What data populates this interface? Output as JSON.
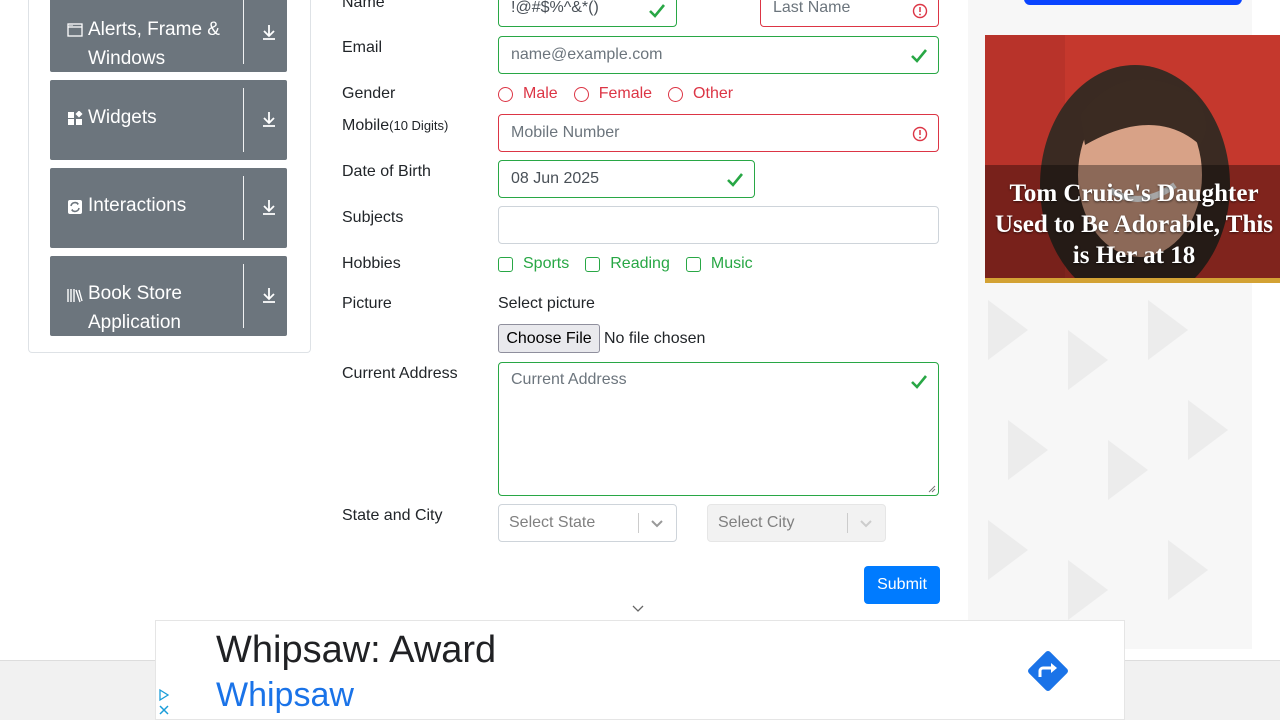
{
  "sidebar": {
    "items": [
      {
        "label_line1": "Alerts, Frame &",
        "label_line2": "Windows",
        "icon": "window-icon"
      },
      {
        "label": "Widgets",
        "icon": "widgets-icon"
      },
      {
        "label": "Interactions",
        "icon": "interactions-icon"
      },
      {
        "label_line1": "Book Store",
        "label_line2": "Application",
        "icon": "book-icon"
      }
    ]
  },
  "form": {
    "name_label": "Name",
    "first_name_value": "!@#$%^&*()",
    "last_name_placeholder": "Last Name",
    "email_label": "Email",
    "email_placeholder": "name@example.com",
    "gender_label": "Gender",
    "genders": [
      "Male",
      "Female",
      "Other"
    ],
    "mobile_label": "Mobile",
    "mobile_hint": "(10 Digits)",
    "mobile_placeholder": "Mobile Number",
    "dob_label": "Date of Birth",
    "dob_value": "08 Jun 2025",
    "subjects_label": "Subjects",
    "hobbies_label": "Hobbies",
    "hobbies": [
      "Sports",
      "Reading",
      "Music"
    ],
    "picture_label": "Picture",
    "select_picture": "Select picture",
    "choose_file": "Choose File",
    "no_file": "No file chosen",
    "address_label": "Current Address",
    "address_placeholder": "Current Address",
    "state_city_label": "State and City",
    "state_placeholder": "Select State",
    "city_placeholder": "Select City",
    "submit_label": "Submit"
  },
  "right_ad": {
    "title": "Tom Cruise's Daughter Used to Be Adorable, This is Her at 18"
  },
  "bottom_ad": {
    "headline": "Whipsaw: Award",
    "brand": "Whipsaw"
  },
  "colors": {
    "valid": "#28a745",
    "invalid": "#dc3545",
    "primary": "#007bff",
    "sidebar": "#6c757d"
  }
}
